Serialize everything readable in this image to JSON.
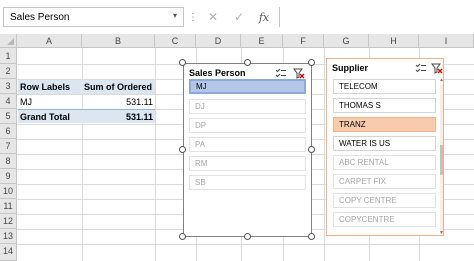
{
  "formula_bar": {
    "name_box": "Sales Person",
    "dots": "⋮",
    "cancel": "✕",
    "enter": "✓",
    "fx": "fx",
    "formula": ""
  },
  "columns": [
    "A",
    "B",
    "C",
    "D",
    "E",
    "F",
    "G",
    "H",
    "I"
  ],
  "rows": [
    "1",
    "2",
    "3",
    "4",
    "5",
    "6",
    "7",
    "8",
    "9",
    "10",
    "11",
    "12",
    "13",
    "14"
  ],
  "pivot": {
    "row_labels_header": "Row Labels",
    "value_header": "Sum of Ordered",
    "rows": [
      {
        "label": "MJ",
        "value": "531.11"
      }
    ],
    "grand_total_label": "Grand Total",
    "grand_total_value": "531.11"
  },
  "slicer_sales_person": {
    "title": "Sales Person",
    "items": [
      {
        "label": "MJ",
        "state": "selected"
      },
      {
        "label": "DJ",
        "state": "dim"
      },
      {
        "label": "DP",
        "state": "dim"
      },
      {
        "label": "PA",
        "state": "dim"
      },
      {
        "label": "RM",
        "state": "dim"
      },
      {
        "label": "SB",
        "state": "dim"
      }
    ]
  },
  "slicer_supplier": {
    "title": "Supplier",
    "items": [
      {
        "label": "TELECOM",
        "state": "normal"
      },
      {
        "label": "THOMAS S",
        "state": "normal"
      },
      {
        "label": "TRANZ",
        "state": "selected"
      },
      {
        "label": "WATER IS US",
        "state": "normal"
      },
      {
        "label": "ABC RENTAL",
        "state": "dim"
      },
      {
        "label": "CARPET FIX",
        "state": "dim"
      },
      {
        "label": "COPY CENTRE",
        "state": "dim"
      },
      {
        "label": "COPYCENTRE",
        "state": "dim"
      }
    ]
  },
  "colors": {
    "pivot_header_fill": "#dce6f1",
    "slicer_selected_blue": "#b4c6e7",
    "slicer_selected_orange": "#f8cbad",
    "supplier_border": "#f4b183",
    "clear_filter_red": "#e00000"
  }
}
